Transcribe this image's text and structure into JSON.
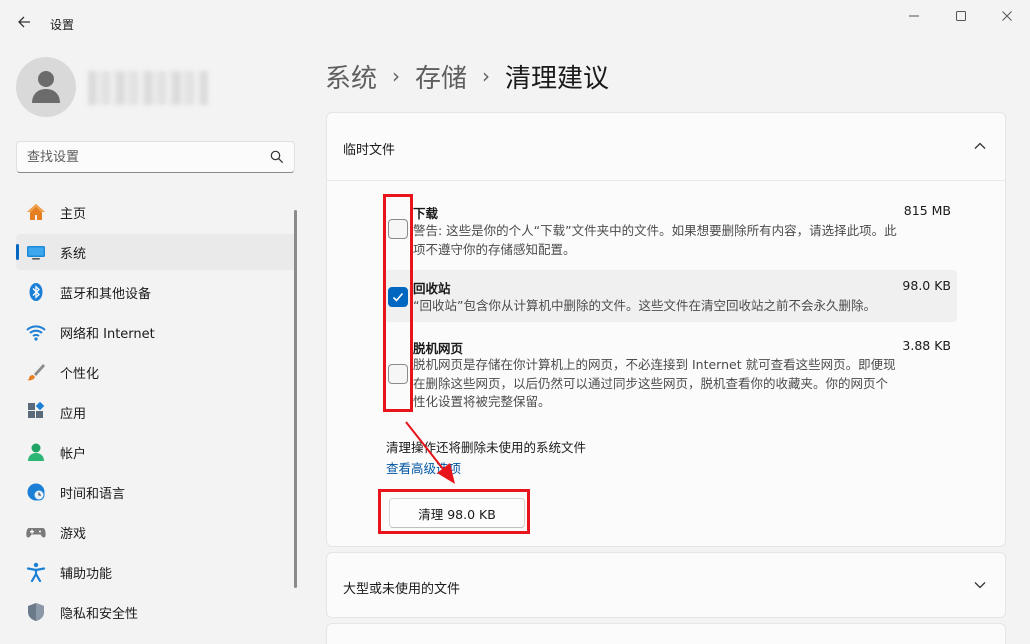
{
  "app": {
    "title": "设置"
  },
  "search": {
    "placeholder": "查找设置"
  },
  "nav": {
    "items": [
      {
        "label": "主页",
        "icon": "home-icon"
      },
      {
        "label": "系统",
        "icon": "monitor-icon",
        "active": true
      },
      {
        "label": "蓝牙和其他设备",
        "icon": "bluetooth-icon"
      },
      {
        "label": "网络和 Internet",
        "icon": "wifi-icon"
      },
      {
        "label": "个性化",
        "icon": "brush-icon"
      },
      {
        "label": "应用",
        "icon": "apps-icon"
      },
      {
        "label": "帐户",
        "icon": "person-icon"
      },
      {
        "label": "时间和语言",
        "icon": "clock-globe-icon"
      },
      {
        "label": "游戏",
        "icon": "gamepad-icon"
      },
      {
        "label": "辅助功能",
        "icon": "accessibility-icon"
      },
      {
        "label": "隐私和安全性",
        "icon": "shield-icon"
      }
    ]
  },
  "breadcrumb": {
    "part1": "系统",
    "part2": "存储",
    "current": "清理建议",
    "separator": "›"
  },
  "temp_files": {
    "title": "临时文件",
    "items": [
      {
        "name": "下载",
        "size": "815 MB",
        "desc_line1": "警告: 这些是你的个人“下载”文件夹中的文件。如果想要删除所有内容，请选择此项。此",
        "desc_line2": "项不遵守你的存储感知配置。",
        "checked": false
      },
      {
        "name": "回收站",
        "size": "98.0 KB",
        "desc_line1": "“回收站”包含你从计算机中删除的文件。这些文件在清空回收站之前不会永久删除。",
        "checked": true
      },
      {
        "name": "脱机网页",
        "size": "3.88 KB",
        "desc_line1": "脱机网页是存储在你计算机上的网页，不必连接到 Internet 就可查看这些网页。即便现",
        "desc_line2": "在删除这些网页，以后仍然可以通过同步这些网页，脱机查看你的收藏夹。你的网页个",
        "desc_line3": "性化设置将被完整保留。",
        "checked": false
      }
    ],
    "note": "清理操作还将删除未使用的系统文件",
    "advanced_link": "查看高级选项",
    "clean_button": "清理 98.0 KB"
  },
  "large_files": {
    "title": "大型或未使用的文件"
  },
  "colors": {
    "accent": "#0067c0",
    "annotation": "#e8141b"
  }
}
